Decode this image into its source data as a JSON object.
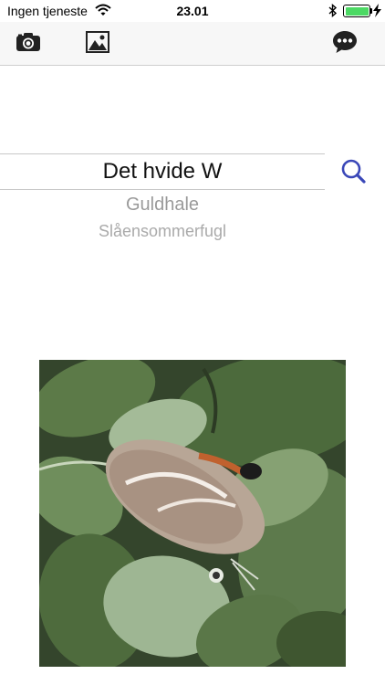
{
  "status_bar": {
    "carrier": "Ingen tjeneste",
    "time": "23.01",
    "battery_level": 1.0,
    "battery_color": "#4cd964"
  },
  "toolbar": {
    "left_icons": [
      "camera-icon",
      "image-icon"
    ],
    "right_icon": "chat-bubble-icon"
  },
  "picker": {
    "selected": "Det hvide W",
    "options": [
      "Guldhale",
      "Slåensommerfugl"
    ]
  },
  "search": {
    "icon": "magnifier-icon",
    "color": "#3a47b8"
  },
  "photo": {
    "subject": "butterfly-photo"
  }
}
